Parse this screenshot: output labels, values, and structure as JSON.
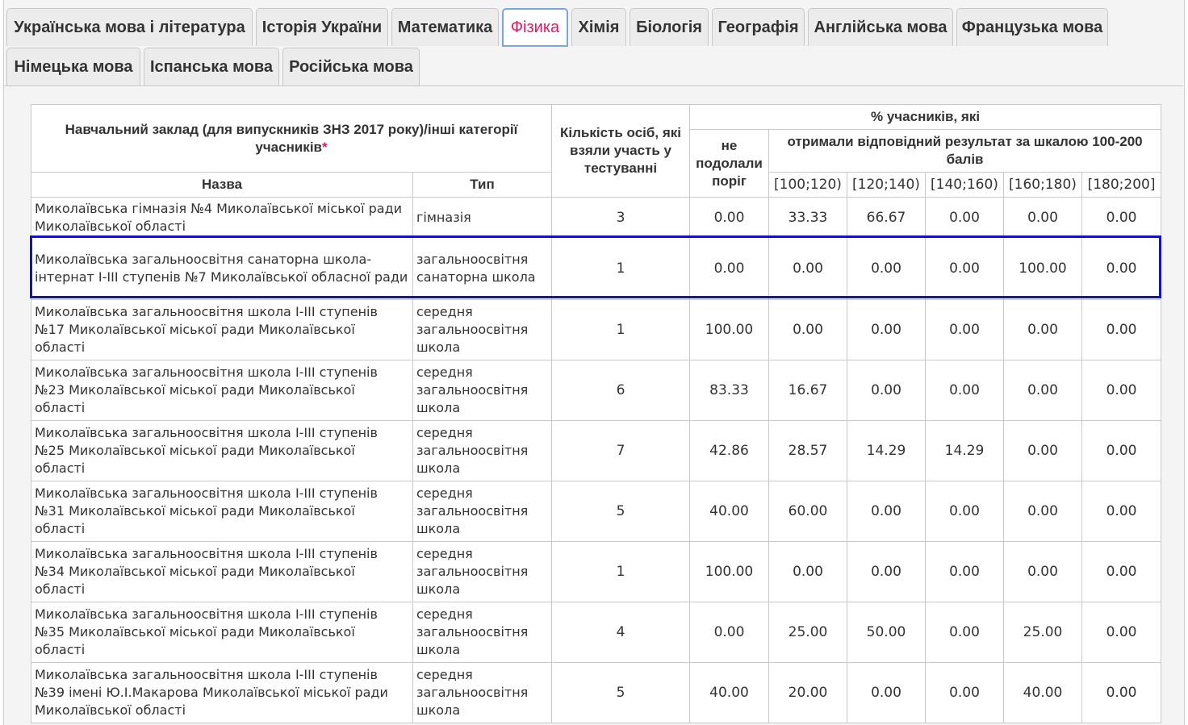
{
  "tabs": [
    {
      "label": "Українська мова і література",
      "active": false
    },
    {
      "label": "Історія України",
      "active": false
    },
    {
      "label": "Математика",
      "active": false
    },
    {
      "label": "Фізика",
      "active": true
    },
    {
      "label": "Хімія",
      "active": false
    },
    {
      "label": "Біологія",
      "active": false
    },
    {
      "label": "Географія",
      "active": false
    },
    {
      "label": "Англійська мова",
      "active": false
    },
    {
      "label": "Французька мова",
      "active": false
    },
    {
      "label": "Німецька мова",
      "active": false
    },
    {
      "label": "Іспанська мова",
      "active": false
    },
    {
      "label": "Російська мова",
      "active": false
    }
  ],
  "table": {
    "header": {
      "institution": "Навчальний заклад (для випускників ЗНЗ 2017 року)/інші категорії учасників",
      "asterisk": "*",
      "name": "Назва",
      "type": "Тип",
      "count": "Кількість осіб, які взяли участь у тестуванні",
      "percent_group": "% учасників, які",
      "not_passed": "не подолали поріг",
      "scale_group": "отримали відповідний результат за шкалою 100-200 балів",
      "ranges": [
        "[100;120)",
        "[120;140)",
        "[140;160)",
        "[160;180)",
        "[180;200]"
      ]
    },
    "rows": [
      {
        "name": "Миколаївська гімназія №4 Миколаївської міської ради Миколаївської області",
        "type": "гімназія",
        "count": "3",
        "not_passed": "0.00",
        "r1": "33.33",
        "r2": "66.67",
        "r3": "0.00",
        "r4": "0.00",
        "r5": "0.00"
      },
      {
        "name": "Миколаївська загальноосвітня санаторна школа-інтернат І-ІІІ ступенів №7 Миколаївської обласної ради",
        "type": "загальноосвітня санаторна школа",
        "count": "1",
        "not_passed": "0.00",
        "r1": "0.00",
        "r2": "0.00",
        "r3": "0.00",
        "r4": "100.00",
        "r5": "0.00"
      },
      {
        "name": "Миколаївська загальноосвітня школа І-ІІІ ступенів №17 Миколаївської міської ради Миколаївської області",
        "type": "середня загальноосвітня школа",
        "count": "1",
        "not_passed": "100.00",
        "r1": "0.00",
        "r2": "0.00",
        "r3": "0.00",
        "r4": "0.00",
        "r5": "0.00"
      },
      {
        "name": "Миколаївська загальноосвітня школа І-ІІІ ступенів №23 Миколаївської міської ради Миколаївської області",
        "type": "середня загальноосвітня школа",
        "count": "6",
        "not_passed": "83.33",
        "r1": "16.67",
        "r2": "0.00",
        "r3": "0.00",
        "r4": "0.00",
        "r5": "0.00"
      },
      {
        "name": "Миколаївська загальноосвітня школа І-ІІІ ступенів №25 Миколаївської міської ради Миколаївської області",
        "type": "середня загальноосвітня школа",
        "count": "7",
        "not_passed": "42.86",
        "r1": "28.57",
        "r2": "14.29",
        "r3": "14.29",
        "r4": "0.00",
        "r5": "0.00"
      },
      {
        "name": "Миколаївська загальноосвітня школа І-ІІІ ступенів №31 Миколаївської міської ради Миколаївської області",
        "type": "середня загальноосвітня школа",
        "count": "5",
        "not_passed": "40.00",
        "r1": "60.00",
        "r2": "0.00",
        "r3": "0.00",
        "r4": "0.00",
        "r5": "0.00"
      },
      {
        "name": "Миколаївська загальноосвітня школа І-ІІІ ступенів №34 Миколаївської міської ради Миколаївської області",
        "type": "середня загальноосвітня школа",
        "count": "1",
        "not_passed": "100.00",
        "r1": "0.00",
        "r2": "0.00",
        "r3": "0.00",
        "r4": "0.00",
        "r5": "0.00"
      },
      {
        "name": "Миколаївська загальноосвітня школа І-ІІІ ступенів №35 Миколаївської міської ради Миколаївської області",
        "type": "середня загальноосвітня школа",
        "count": "4",
        "not_passed": "0.00",
        "r1": "25.00",
        "r2": "50.00",
        "r3": "0.00",
        "r4": "25.00",
        "r5": "0.00"
      },
      {
        "name": "Миколаївська загальноосвітня школа І-ІІІ ступенів №39 імені Ю.І.Макарова Миколаївської міської ради Миколаївської області",
        "type": "середня загальноосвітня школа",
        "count": "5",
        "not_passed": "40.00",
        "r1": "20.00",
        "r2": "0.00",
        "r3": "0.00",
        "r4": "40.00",
        "r5": "0.00"
      }
    ]
  },
  "colors": {
    "active_tab_text": "#e0185f",
    "active_tab_border": "#7aa7d8",
    "highlight_border": "#1010d0",
    "grid_border": "#c9c9c9"
  }
}
